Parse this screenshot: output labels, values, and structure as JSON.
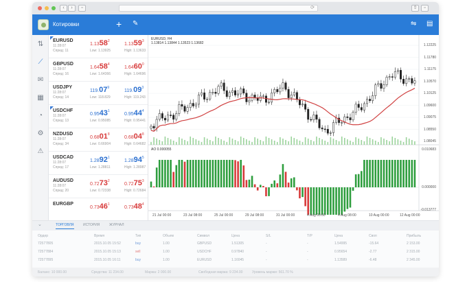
{
  "toolbar": {
    "title": "Котировки"
  },
  "quotes": [
    {
      "symbol": "EURUSD",
      "time": "11:28:07",
      "spread": "Спред: 11",
      "bid_main": "1.13",
      "bid_big": "58",
      "bid_sup": "2",
      "ask_main": "1.13",
      "ask_big": "59",
      "ask_sup": "3",
      "low": "Low: 1.13925",
      "high": "High: 1.13633",
      "bid_color": "red",
      "ask_color": "red"
    },
    {
      "symbol": "GBPUSD",
      "time": "11:28:07",
      "spread": "Спред: 16",
      "bid_main": "1.64",
      "bid_big": "58",
      "bid_sup": "4",
      "ask_main": "1.64",
      "ask_big": "60",
      "ask_sup": "0",
      "low": "Low: 1.64366",
      "high": "High: 1.64696",
      "bid_color": "red",
      "ask_color": "red"
    },
    {
      "symbol": "USDJPY",
      "time": "11:28:07",
      "spread": "Спред: 14",
      "bid_main": "119.",
      "bid_big": "07",
      "bid_sup": "9",
      "ask_main": "119.",
      "ask_big": "09",
      "ask_sup": "3",
      "low": "Low: 118.829",
      "high": "High: 119.243",
      "bid_color": "blue",
      "ask_color": "blue"
    },
    {
      "symbol": "USDCHF",
      "time": "11:28:07",
      "spread": "Спред: 13",
      "bid_main": "0.95",
      "bid_big": "43",
      "bid_sup": "1",
      "ask_main": "0.95",
      "ask_big": "44",
      "ask_sup": "4",
      "low": "Low: 0.95085",
      "high": "High: 0.95441",
      "bid_color": "blue",
      "ask_color": "blue"
    },
    {
      "symbol": "NZDUSD",
      "time": "11:28:07",
      "spread": "Спред: 34",
      "bid_main": "0.68",
      "bid_big": "01",
      "bid_sup": "8",
      "ask_main": "0.68",
      "ask_big": "04",
      "ask_sup": "8",
      "low": "Low: 0.66904",
      "high": "High: 0.64682",
      "bid_color": "red",
      "ask_color": "red"
    },
    {
      "symbol": "USDCAD",
      "time": "11:28:07",
      "spread": "Спред: 17",
      "bid_main": "1.28",
      "bid_big": "92",
      "bid_sup": "1",
      "ask_main": "1.28",
      "ask_big": "94",
      "ask_sup": "5",
      "low": "Low: 1.28811",
      "high": "High: 1.28987",
      "bid_color": "blue",
      "ask_color": "blue"
    },
    {
      "symbol": "AUDUSD",
      "time": "11:28:07",
      "spread": "Спред: 20",
      "bid_main": "0.72",
      "bid_big": "73",
      "bid_sup": "2",
      "ask_main": "0.72",
      "ask_big": "75",
      "ask_sup": "3",
      "low": "Low: 0.72338",
      "high": "High: 0.72684",
      "bid_color": "red",
      "ask_color": "red"
    },
    {
      "symbol": "EURGBP",
      "time": "",
      "spread": "",
      "bid_main": "0.73",
      "bid_big": "46",
      "bid_sup": "1",
      "ask_main": "0.73",
      "ask_big": "48",
      "ask_sup": "4",
      "low": "",
      "high": "",
      "bid_color": "red",
      "ask_color": "red"
    }
  ],
  "chart": {
    "header_line1": "EURUSD, H4",
    "header_line2": "1.13814 1.13844 1.13523 1.13682",
    "indicator_label": "AO 0.000055",
    "price_labels": [
      "1.12225",
      "1.11780",
      "1.11175",
      "1.10570",
      "1.10125",
      "1.09600",
      "1.09075",
      "1.08550",
      "1.08045"
    ],
    "indicator_labels": [
      "0.010683",
      "0.000000",
      "-0.013777"
    ],
    "date_labels": [
      "21 Jul 00:00",
      "23 Jul 08:00",
      "25 Jul 00:00",
      "29 Jul 08:00",
      "31 Jul 00:00",
      "4 Aug 00:00",
      "4 Aug 08:00",
      "10 Aug 00:00",
      "12 Aug 00:00"
    ],
    "colors": {
      "up": "#d73a3a",
      "down": "#2e9e3e",
      "ma": "#d04040",
      "candle": "#222222"
    }
  },
  "bottom": {
    "tabs": [
      "ТОРГОВЛЯ",
      "ИСТОРИЯ",
      "ЖУРНАЛ"
    ],
    "headers": [
      "Ордер",
      "Время",
      "Тип",
      "Объем",
      "Символ",
      "Цена",
      "S/L",
      "T/P",
      "Цена",
      "Своп",
      "Прибыль"
    ],
    "rows": [
      [
        "72577805",
        "2015.10.05 15:52",
        "buy",
        "1.00",
        "GBPUSD",
        "1.51305",
        "-",
        "-",
        "1.54995",
        "-15.64",
        "2 153.00"
      ],
      [
        "72577884",
        "2015.10.05 15:13",
        "sell",
        "1.00",
        "USDCHF",
        "0.97840",
        "-",
        "-",
        "0.95654",
        "-2.77",
        "2 315.00"
      ],
      [
        "72577895",
        "2015.10.05 16:11",
        "buy",
        "1.00",
        "EURUSD",
        "1.16045",
        "-",
        "-",
        "1.13589",
        "-6.48",
        "2 345.00"
      ]
    ],
    "footer": [
      "Баланс: 10 000.00",
      "Средства: 11 234.00",
      "Маржа: 2 000.00",
      "Свободная маржа: 9 234.00",
      "Уровень маржи: 561.70 %"
    ]
  }
}
